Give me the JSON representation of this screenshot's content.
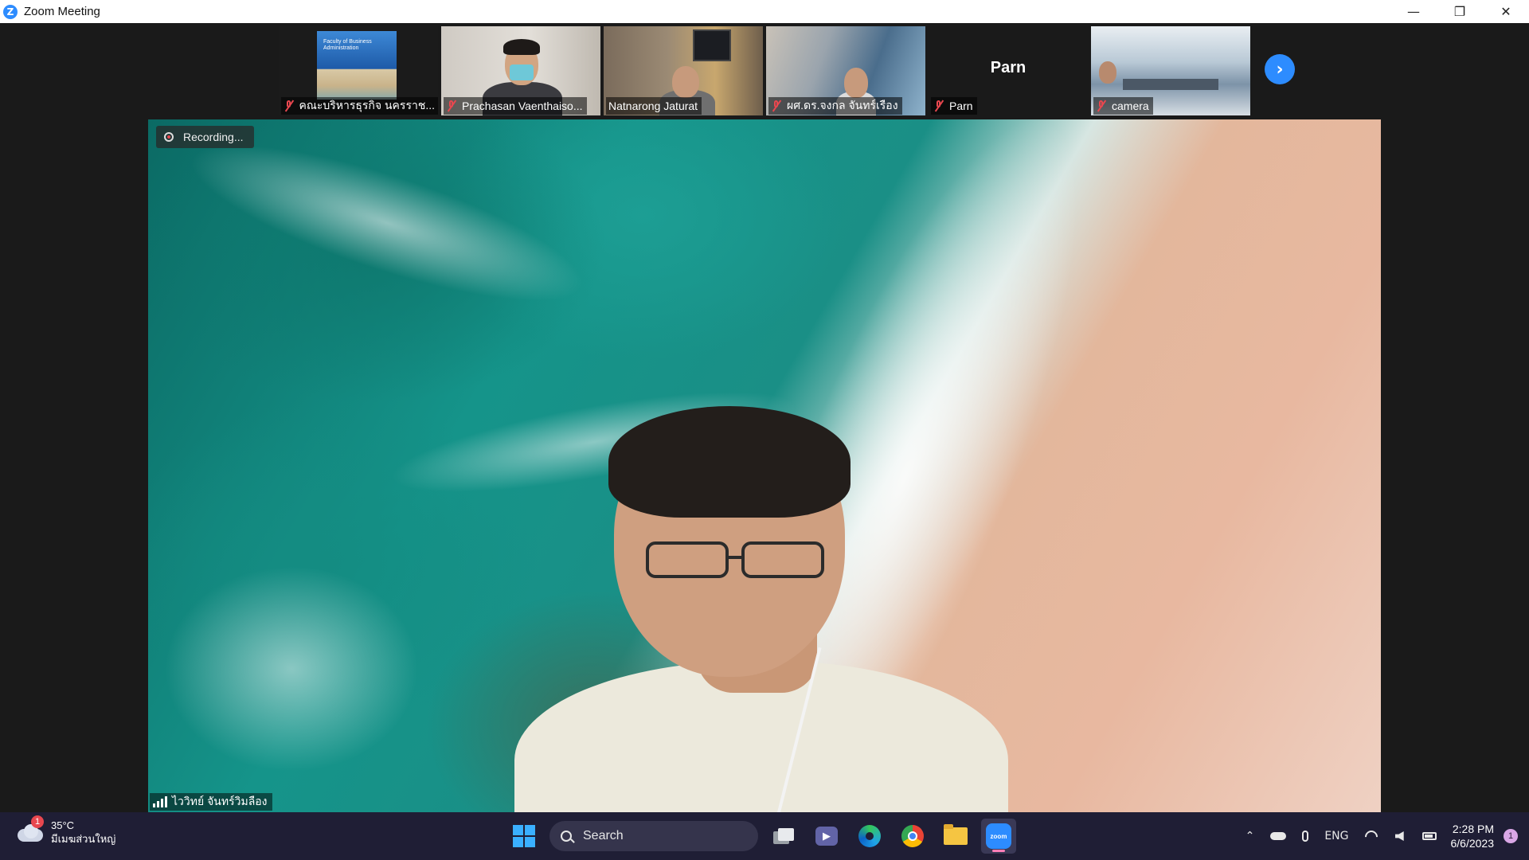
{
  "window": {
    "title": "Zoom Meeting",
    "controls": {
      "minimize": "—",
      "restore": "❐",
      "close": "✕"
    }
  },
  "participants": [
    {
      "name": "คณะบริหารธุรกิจ นครราช...",
      "muted": true,
      "tile": "office-poster",
      "poster_text": "Faculty of Business Administration"
    },
    {
      "name": "Prachasan Vaenthaiso...",
      "muted": true,
      "tile": "room-mask"
    },
    {
      "name": "Natnarong Jaturat",
      "muted": false,
      "tile": "meeting-room"
    },
    {
      "name": "ผศ.ดร.จงกล จันทร์เรือง",
      "muted": true,
      "tile": "gallery-room"
    },
    {
      "name": "Parn",
      "muted": true,
      "tile": "name-only",
      "display_name": "Parn"
    },
    {
      "name": "camera",
      "muted": true,
      "tile": "classroom"
    }
  ],
  "next_page_icon": "chevron-right-icon",
  "main_video": {
    "recording_label": "Recording...",
    "speaker_name": "ไววิทย์ จันทร์วิมลือง",
    "background": "beach-aerial"
  },
  "taskbar": {
    "weather": {
      "temp": "35°C",
      "desc": "มีเมฆส่วนใหญ่",
      "badge": "1"
    },
    "search_label": "Search",
    "apps": [
      "task-view",
      "teams",
      "edge",
      "chrome",
      "file-explorer",
      "zoom"
    ],
    "zoom_label": "zoom",
    "tray": {
      "lang": "ENG",
      "time": "2:28 PM",
      "date": "6/6/2023",
      "notifications": "1"
    }
  },
  "colors": {
    "zoom_blue": "#2d8cff",
    "muted_red": "#e8474f",
    "taskbar_bg": "#1f1e35",
    "stage_bg": "#1a1a1a"
  }
}
